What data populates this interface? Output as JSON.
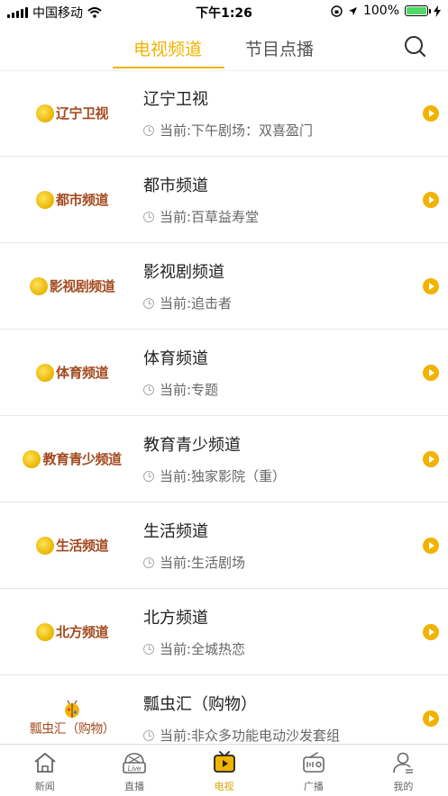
{
  "status": {
    "carrier": "中国移动",
    "time": "下午1:26",
    "battery": "100%"
  },
  "header": {
    "tab_tv": "电视频道",
    "tab_vod": "节目点播"
  },
  "channels": [
    {
      "logo": "辽宁卫视",
      "name": "辽宁卫视",
      "now": "当前:下午剧场：双喜盈门"
    },
    {
      "logo": "都市频道",
      "name": "都市频道",
      "now": "当前:百草益寿堂"
    },
    {
      "logo": "影视剧频道",
      "name": "影视剧频道",
      "now": "当前:追击者"
    },
    {
      "logo": "体育频道",
      "name": "体育频道",
      "now": "当前:专题"
    },
    {
      "logo": "教育青少频道",
      "name": "教育青少频道",
      "now": "当前:独家影院（重）"
    },
    {
      "logo": "生活频道",
      "name": "生活频道",
      "now": "当前:生活剧场"
    },
    {
      "logo": "北方频道",
      "name": "北方频道",
      "now": "当前:全城热恋"
    },
    {
      "logo": "瓢虫汇（购物）",
      "name": "瓢虫汇（购物）",
      "now": "当前:非众多功能电动沙发套组"
    }
  ],
  "nav": {
    "news": "新闻",
    "live": "直播",
    "tv": "电视",
    "radio": "广播",
    "mine": "我的",
    "live_badge": "Live"
  },
  "colors": {
    "accent": "#f1b300",
    "logo_text": "#a34a1f"
  }
}
